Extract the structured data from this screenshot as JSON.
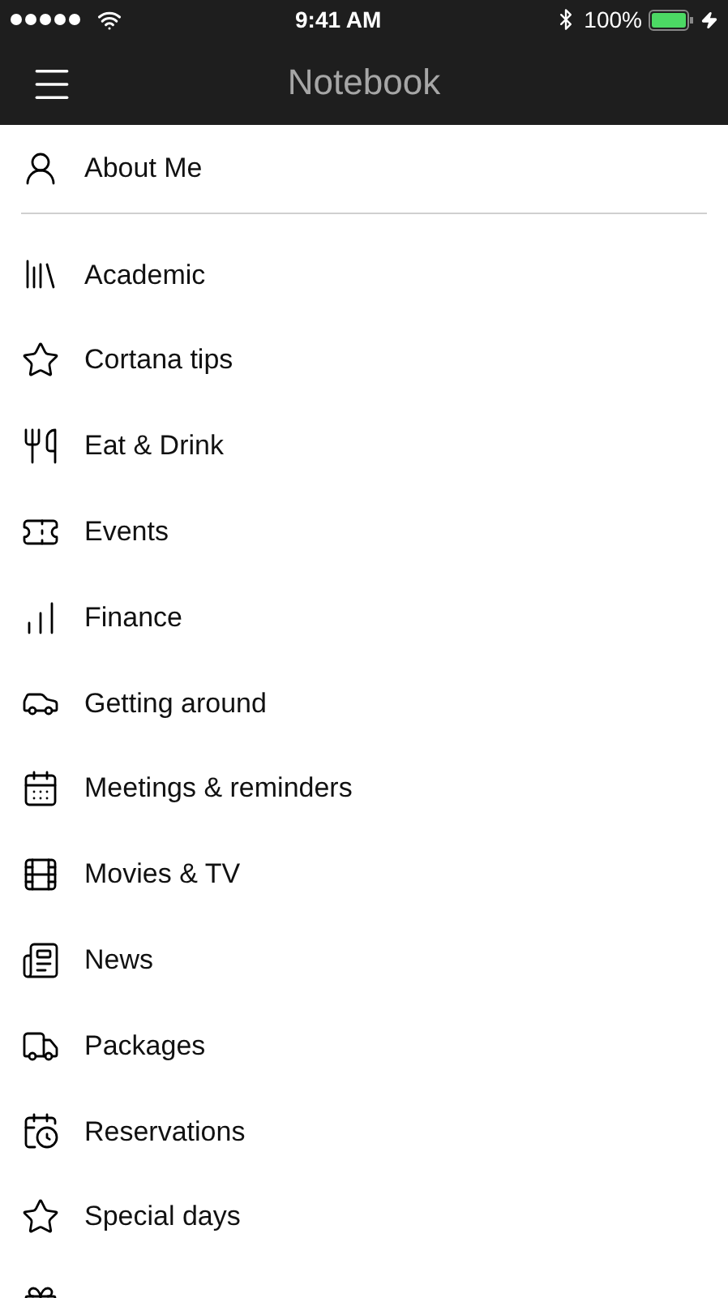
{
  "status_bar": {
    "time": "9:41 AM",
    "battery": "100%"
  },
  "header": {
    "title": "Notebook"
  },
  "profile_item": {
    "label": "About Me"
  },
  "items": [
    {
      "label": "Academic"
    },
    {
      "label": "Cortana tips"
    },
    {
      "label": "Eat & Drink"
    },
    {
      "label": "Events"
    },
    {
      "label": "Finance"
    },
    {
      "label": "Getting around"
    },
    {
      "label": "Meetings & reminders"
    },
    {
      "label": "Movies & TV"
    },
    {
      "label": "News"
    },
    {
      "label": "Packages"
    },
    {
      "label": "Reservations"
    },
    {
      "label": "Special days"
    }
  ]
}
